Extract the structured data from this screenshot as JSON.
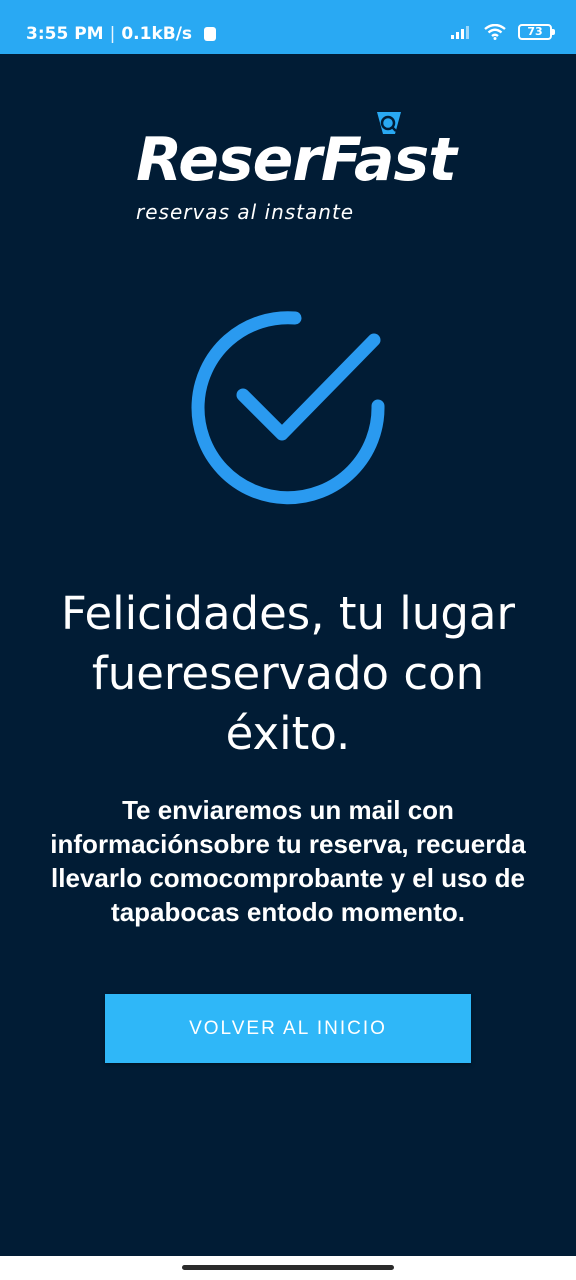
{
  "status_bar": {
    "time": "3:55 PM",
    "separator": "|",
    "speed": "0.1kB/s",
    "battery": "73",
    "bg_color": "#29a9f3"
  },
  "logo": {
    "name": "ReserFast",
    "tagline": "reservas al instante"
  },
  "success": {
    "icon": "check-circle-icon",
    "icon_color": "#2a9af0",
    "headline": "Felicidades, tu lugar fuereservado con éxito.",
    "message": "Te enviaremos un mail con informaciónsobre tu reserva, recuerda llevarlo comocomprobante y el uso de tapabocas entodo momento."
  },
  "actions": {
    "back_home": "VOLVER AL INICIO",
    "button_color": "#2fb7f8"
  },
  "theme": {
    "background": "#011c35"
  }
}
